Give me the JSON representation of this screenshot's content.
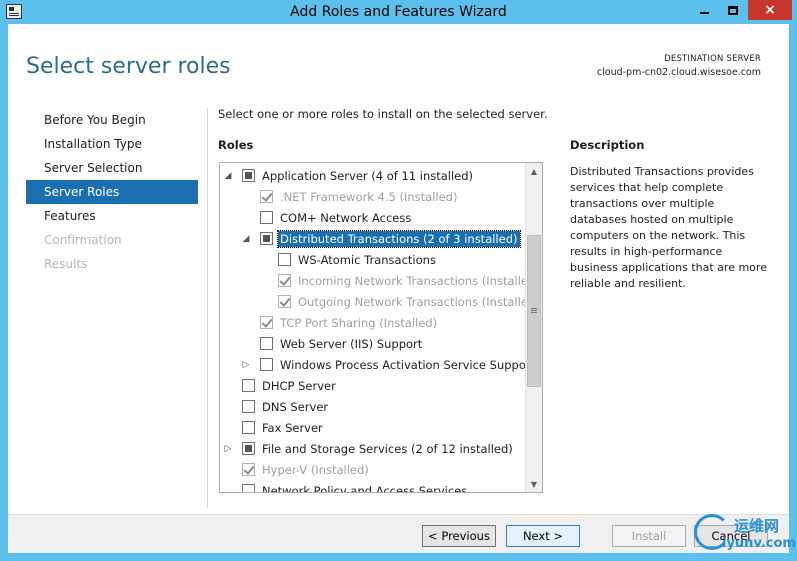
{
  "window": {
    "title": "Add Roles and Features Wizard",
    "controls": {
      "minimize": "minimize",
      "maximize": "maximize",
      "close": "×"
    }
  },
  "header": {
    "page_title": "Select server roles",
    "destination_label": "DESTINATION SERVER",
    "destination_value": "cloud-pm-cn02.cloud.wisesoe.com"
  },
  "nav": {
    "items": [
      {
        "label": "Before You Begin",
        "state": "normal"
      },
      {
        "label": "Installation Type",
        "state": "normal"
      },
      {
        "label": "Server Selection",
        "state": "normal"
      },
      {
        "label": "Server Roles",
        "state": "active"
      },
      {
        "label": "Features",
        "state": "normal"
      },
      {
        "label": "Confirmation",
        "state": "disabled"
      },
      {
        "label": "Results",
        "state": "disabled"
      }
    ]
  },
  "main": {
    "intro": "Select one or more roles to install on the selected server.",
    "roles_label": "Roles",
    "description_label": "Description",
    "description_text": "Distributed Transactions provides services that help complete transactions over multiple databases hosted on multiple computers on the network. This results in high-performance business applications that are more reliable and resilient."
  },
  "roles": [
    {
      "label": "Application Server (4 of 11 installed)",
      "expander": "◢",
      "check": "partial",
      "grey": false
    },
    {
      "label": ".NET Framework 4.5 (Installed)",
      "expander": "",
      "check": "checked",
      "grey": true
    },
    {
      "label": "COM+ Network Access",
      "expander": "",
      "check": "none",
      "grey": false
    },
    {
      "label": "Distributed Transactions (2 of 3 installed)",
      "expander": "◢",
      "check": "partial",
      "grey": false,
      "selected": true
    },
    {
      "label": "WS-Atomic Transactions",
      "expander": "",
      "check": "none",
      "grey": false
    },
    {
      "label": "Incoming Network Transactions (Installed)",
      "expander": "",
      "check": "checked",
      "grey": true
    },
    {
      "label": "Outgoing Network Transactions (Installed)",
      "expander": "",
      "check": "checked",
      "grey": true
    },
    {
      "label": "TCP Port Sharing (Installed)",
      "expander": "",
      "check": "checked",
      "grey": true
    },
    {
      "label": "Web Server (IIS) Support",
      "expander": "",
      "check": "none",
      "grey": false
    },
    {
      "label": "Windows Process Activation Service Support",
      "expander": "▷",
      "check": "none",
      "grey": false
    },
    {
      "label": "DHCP Server",
      "expander": "",
      "check": "none",
      "grey": false
    },
    {
      "label": "DNS Server",
      "expander": "",
      "check": "none",
      "grey": false
    },
    {
      "label": "Fax Server",
      "expander": "",
      "check": "none",
      "grey": false
    },
    {
      "label": "File and Storage Services (2 of 12 installed)",
      "expander": "▷",
      "check": "partial",
      "grey": false
    },
    {
      "label": "Hyper-V (Installed)",
      "expander": "",
      "check": "checked",
      "grey": true
    },
    {
      "label": "Network Policy and Access Services",
      "expander": "",
      "check": "none",
      "grey": false
    }
  ],
  "scrollbar": {
    "up": "▲",
    "down": "▼"
  },
  "footer": {
    "previous": "< Previous",
    "next": "Next >",
    "install": "Install",
    "cancel": "Cancel"
  },
  "watermark": {
    "cn": "运维网",
    "url": "iyunv.com"
  }
}
